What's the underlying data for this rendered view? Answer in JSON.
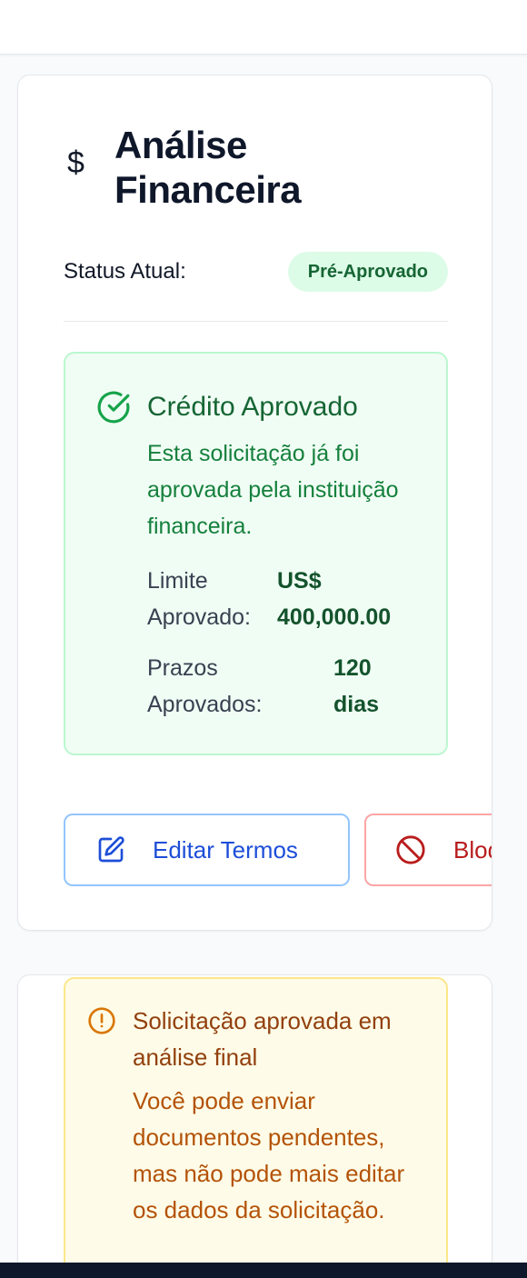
{
  "header": {
    "icon": "chevron-down-icon"
  },
  "finance_card": {
    "icon": "dollar-icon",
    "icon_glyph": "$",
    "title": "Análise Financeira",
    "status_label": "Status Atual:",
    "status_badge": "Pré-Aprovado",
    "approved": {
      "icon": "check-circle-icon",
      "title": "Crédito Aprovado",
      "description": "Esta solicitação já foi aprovada pela instituição financeira.",
      "limit_label": "Limite Aprovado:",
      "limit_value": "US$ 400,000.00",
      "terms_label": "Prazos Aprovados:",
      "terms_value": "120 dias"
    },
    "buttons": {
      "edit": {
        "icon": "edit-icon",
        "label": "Editar Termos"
      },
      "block": {
        "icon": "ban-icon",
        "label": "Bloquear"
      }
    }
  },
  "warning_card": {
    "icon": "alert-circle-icon",
    "title": "Solicitação aprovada em análise final",
    "description": "Você pode enviar documentos pendentes, mas não pode mais editar os dados da solicitação."
  },
  "colors": {
    "success_bg": "#f0fdf4",
    "success_text": "#166534",
    "primary": "#1d4ed8",
    "danger": "#b91c1c",
    "warning_text": "#b45309"
  }
}
